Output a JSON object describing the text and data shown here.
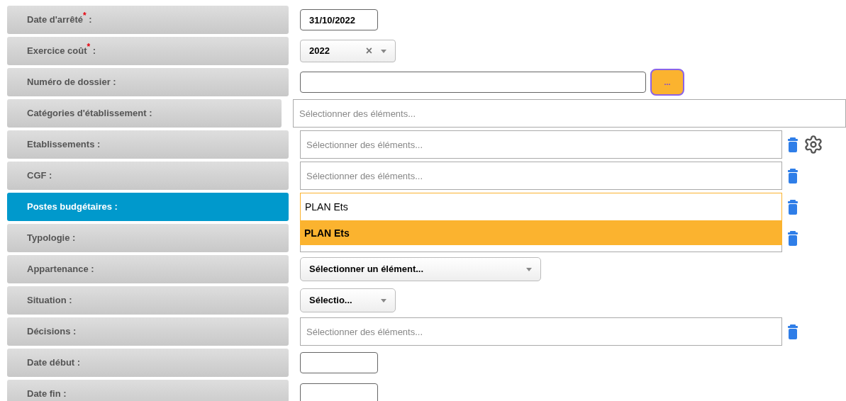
{
  "rows": [
    {
      "label": "Date d'arrêté$^{*}$ :",
      "active": false,
      "field": {
        "kind": "date",
        "value": "31/10/2022"
      }
    },
    {
      "label": "Exercice coût$^{*}$ :",
      "active": false,
      "field": {
        "kind": "select_clear",
        "value": "2022",
        "clear": "×"
      }
    },
    {
      "label": "Numéro de dossier :",
      "active": false,
      "field": {
        "kind": "text_button",
        "button": "..."
      }
    },
    {
      "label": "Catégories d'établissement :",
      "active": false,
      "field": {
        "kind": "multi_wide",
        "placeholder": "Sélectionner des éléments..."
      }
    },
    {
      "label": "Etablissements :",
      "active": false,
      "field": {
        "kind": "multi",
        "placeholder": "Sélectionner des éléments..."
      },
      "trash": true,
      "gear": true
    },
    {
      "label": "CGF :",
      "active": false,
      "field": {
        "kind": "multi",
        "placeholder": "Sélectionner des éléments..."
      },
      "trash": true,
      "gear": false
    },
    {
      "label": "Postes budgétaires :",
      "active": true,
      "field": {
        "kind": "search",
        "value": "PLAN Ets",
        "options": [
          {
            "label": "PLAN Ets",
            "selected": true
          }
        ]
      },
      "trash": true,
      "gear": false
    },
    {
      "label": "Typologie :",
      "active": false,
      "field": {
        "kind": "multi_hidden"
      },
      "trash": true,
      "gear": false
    },
    {
      "label": "Appartenance :",
      "active": false,
      "field": {
        "kind": "select_wide",
        "value": "Sélectionner un élément..."
      }
    },
    {
      "label": "Situation :",
      "active": false,
      "field": {
        "kind": "select_narrow",
        "value": "Sélectio..."
      }
    },
    {
      "label": "Décisions :",
      "active": false,
      "field": {
        "kind": "multi",
        "placeholder": "Sélectionner des éléments..."
      },
      "trash": true,
      "gear": false
    },
    {
      "label": "Date début :",
      "active": false,
      "field": {
        "kind": "date"
      }
    },
    {
      "label": "Date fin :",
      "active": false,
      "field": {
        "kind": "date"
      }
    }
  ]
}
